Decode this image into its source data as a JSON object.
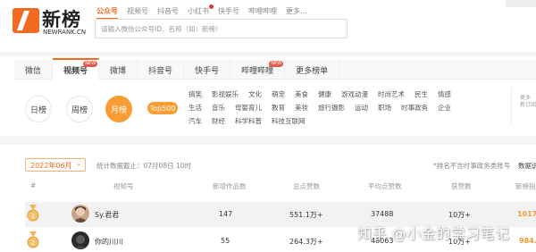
{
  "logo": {
    "text_cn": "新榜",
    "text_en": "NEWRANK.CN"
  },
  "top_tabs": [
    {
      "label": "公众号",
      "active": true
    },
    {
      "label": "视频号",
      "active": false
    },
    {
      "label": "抖音号",
      "active": false
    },
    {
      "label": "小红书",
      "active": false,
      "dot": true
    },
    {
      "label": "快手号",
      "active": false
    },
    {
      "label": "哔哩哔哩",
      "active": false
    },
    {
      "label": "更多...",
      "active": false
    }
  ],
  "search": {
    "placeholder": "请输入微信公众号ID、名称（如：新榜）"
  },
  "platform_tabs": [
    {
      "label": "微信",
      "active": false
    },
    {
      "label": "视频号",
      "active": true,
      "badge": "NEW"
    },
    {
      "label": "微博",
      "active": false
    },
    {
      "label": "抖音号",
      "active": false
    },
    {
      "label": "快手号",
      "active": false
    },
    {
      "label": "哔哩哔哩",
      "active": false,
      "badge": "NEW"
    },
    {
      "label": "更多榜单",
      "active": false
    }
  ],
  "periods": [
    {
      "label": "日榜",
      "active": false
    },
    {
      "label": "周榜",
      "active": false
    },
    {
      "label": "月榜",
      "active": true
    }
  ],
  "top500": "Top500",
  "categories": [
    [
      "搞笑",
      "影视娱乐",
      "文化",
      "萌宠",
      "美食",
      "健康",
      "游戏动漫",
      "时尚艺术",
      "民生",
      "情感"
    ],
    [
      "生活",
      "音乐",
      "母婴育儿",
      "教育",
      "美妆",
      "旅行摄影",
      "运动",
      "职场",
      "时事政务",
      "企业"
    ],
    [
      "汽车",
      "财经",
      "科学科普",
      "科技互联网"
    ]
  ],
  "more_right": "更多 新订阅",
  "filter": {
    "date": "2022年06月",
    "stats_note": "统计数据截止：07月08日 10时",
    "excl_note": "*排名不含时事政务类账号",
    "data_explain": "数据说"
  },
  "table": {
    "headers": [
      "#",
      "视频号",
      "新增作品数",
      "总点赞数",
      "平均点赞数",
      "获赞数",
      "新榜指"
    ],
    "rows": [
      {
        "name": "Sy.君君",
        "new_works": "147",
        "total_likes": "551.1万+",
        "avg_likes": "37488",
        "received_likes": "10万+",
        "index": "1017."
      },
      {
        "name": "你的川川",
        "new_works": "55",
        "total_likes": "264.3万+",
        "avg_likes": "48063",
        "received_likes": "10万+",
        "index": "984.1"
      }
    ]
  },
  "watermark": "知乎 @小金的学习笔记",
  "colors": {
    "accent": "#f36b21",
    "gold": "#f39a2e",
    "badge": "#e35b4a"
  }
}
